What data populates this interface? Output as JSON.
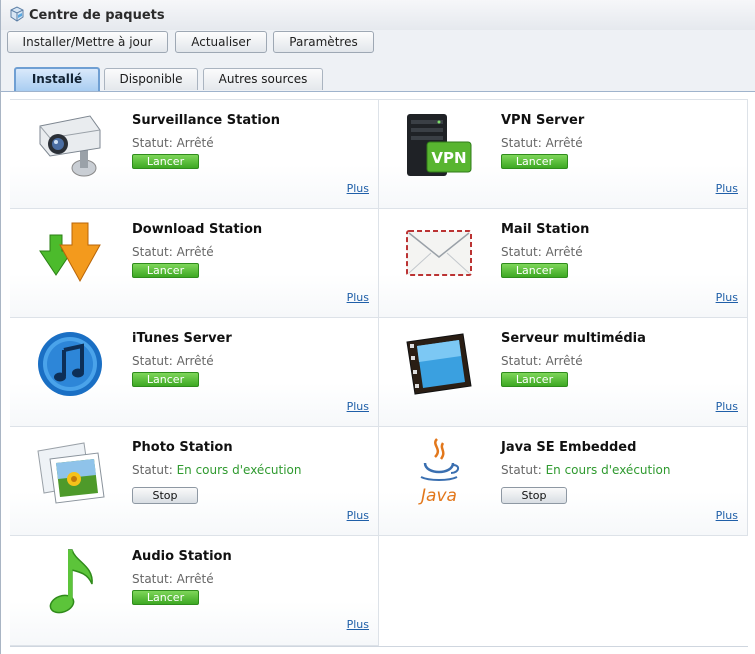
{
  "window": {
    "title": "Centre de paquets"
  },
  "toolbar": {
    "install_label": "Installer/Mettre à jour",
    "refresh_label": "Actualiser",
    "settings_label": "Paramètres"
  },
  "tabs": [
    {
      "label": "Installé",
      "active": true
    },
    {
      "label": "Disponible",
      "active": false
    },
    {
      "label": "Autres sources",
      "active": false
    }
  ],
  "status_prefix": "Statut:",
  "more_label": "Plus",
  "packages": [
    {
      "name": "Surveillance Station",
      "status": "Arrêté",
      "action": "Lancer",
      "icon": "surveillance-camera-icon"
    },
    {
      "name": "VPN Server",
      "status": "Arrêté",
      "action": "Lancer",
      "icon": "vpn-server-icon"
    },
    {
      "name": "Download Station",
      "status": "Arrêté",
      "action": "Lancer",
      "icon": "download-arrows-icon"
    },
    {
      "name": "Mail Station",
      "status": "Arrêté",
      "action": "Lancer",
      "icon": "mail-envelope-icon"
    },
    {
      "name": "iTunes Server",
      "status": "Arrêté",
      "action": "Lancer",
      "icon": "itunes-note-icon"
    },
    {
      "name": "Serveur multimédia",
      "status": "Arrêté",
      "action": "Lancer",
      "icon": "media-film-icon"
    },
    {
      "name": "Photo Station",
      "status": "En cours d'exécution",
      "action": "Stop",
      "icon": "photo-frames-icon"
    },
    {
      "name": "Java SE Embedded",
      "status": "En cours d'exécution",
      "action": "Stop",
      "icon": "java-cup-icon"
    },
    {
      "name": "Audio Station",
      "status": "Arrêté",
      "action": "Lancer",
      "icon": "music-note-icon"
    }
  ],
  "colors": {
    "launch_green": "#3ea823",
    "running_status": "#2f9a2f",
    "link_blue": "#1f5fa8",
    "active_tab": "#a9cdf1"
  }
}
